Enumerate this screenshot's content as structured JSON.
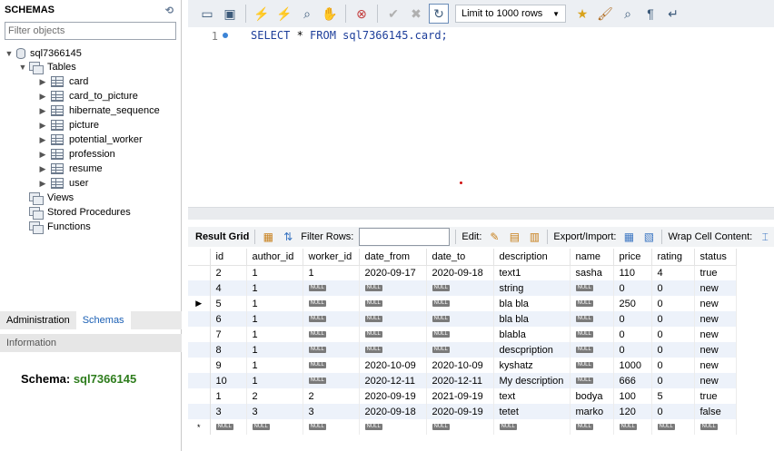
{
  "left_panel": {
    "header": "SCHEMAS",
    "filter_placeholder": "Filter objects",
    "schema_name": "sql7366145",
    "tables_label": "Tables",
    "tables": [
      "card",
      "card_to_picture",
      "hibernate_sequence",
      "picture",
      "potential_worker",
      "profession",
      "resume",
      "user"
    ],
    "views_label": "Views",
    "procedures_label": "Stored Procedures",
    "functions_label": "Functions",
    "tabs": [
      "Administration",
      "Schemas"
    ],
    "active_tab": "Schemas",
    "info_label": "Information",
    "schema_info_label": "Schema:",
    "schema_info_value": "sql7366145"
  },
  "toolbar": {
    "limit_label": "Limit to 1000 rows"
  },
  "editor": {
    "line_number": "1",
    "sql_select": "SELECT",
    "sql_star": " * ",
    "sql_from": "FROM",
    "sql_target": " sql7366145.card;"
  },
  "result_toolbar": {
    "result_grid": "Result Grid",
    "filter_rows": "Filter Rows:",
    "edit": "Edit:",
    "export_import": "Export/Import:",
    "wrap_cell": "Wrap Cell Content:"
  },
  "grid": {
    "null_label": "NULL",
    "columns": [
      "id",
      "author_id",
      "worker_id",
      "date_from",
      "date_to",
      "description",
      "name",
      "price",
      "rating",
      "status"
    ],
    "rows": [
      [
        "2",
        "1",
        "1",
        "2020-09-17",
        "2020-09-18",
        "text1",
        "sasha",
        "110",
        "4",
        "true"
      ],
      [
        "4",
        "1",
        null,
        null,
        null,
        "string",
        null,
        "0",
        "0",
        "new"
      ],
      [
        "5",
        "1",
        null,
        null,
        null,
        "bla bla",
        null,
        "250",
        "0",
        "new"
      ],
      [
        "6",
        "1",
        null,
        null,
        null,
        "bla bla",
        null,
        "0",
        "0",
        "new"
      ],
      [
        "7",
        "1",
        null,
        null,
        null,
        "blabla",
        null,
        "0",
        "0",
        "new"
      ],
      [
        "8",
        "1",
        null,
        null,
        null,
        "descpription",
        null,
        "0",
        "0",
        "new"
      ],
      [
        "9",
        "1",
        null,
        "2020-10-09",
        "2020-10-09",
        "kyshatz",
        null,
        "1000",
        "0",
        "new"
      ],
      [
        "10",
        "1",
        null,
        "2020-12-11",
        "2020-12-11",
        "My description",
        null,
        "666",
        "0",
        "new"
      ],
      [
        "1",
        "2",
        "2",
        "2020-09-19",
        "2021-09-19",
        "text",
        "bodya",
        "100",
        "5",
        "true"
      ],
      [
        "3",
        "3",
        "3",
        "2020-09-18",
        "2020-09-19",
        "tetet",
        "marko",
        "120",
        "0",
        "false"
      ]
    ],
    "current_row_marker": "▶",
    "new_row_marker": "*"
  }
}
